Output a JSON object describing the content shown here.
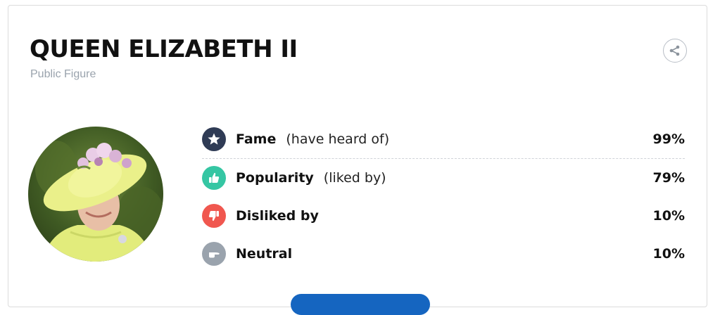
{
  "profile": {
    "name": "QUEEN ELIZABETH II",
    "category": "Public Figure"
  },
  "colors": {
    "fame": "#2f3b55",
    "popularity": "#35c6a3",
    "disliked": "#f0574f",
    "neutral": "#9aa3ad",
    "cta": "#1565c0"
  },
  "stats": [
    {
      "label": "Fame",
      "qualifier": "(have heard of)",
      "value": "99%",
      "icon": "star-icon"
    },
    {
      "label": "Popularity",
      "qualifier": "(liked by)",
      "value": "79%",
      "icon": "thumbs-up-icon"
    },
    {
      "label": "Disliked by",
      "qualifier": "",
      "value": "10%",
      "icon": "thumbs-down-icon"
    },
    {
      "label": "Neutral",
      "qualifier": "",
      "value": "10%",
      "icon": "hand-point-icon"
    }
  ],
  "icons": {
    "share": "share-icon",
    "avatar": "portrait-photo"
  }
}
